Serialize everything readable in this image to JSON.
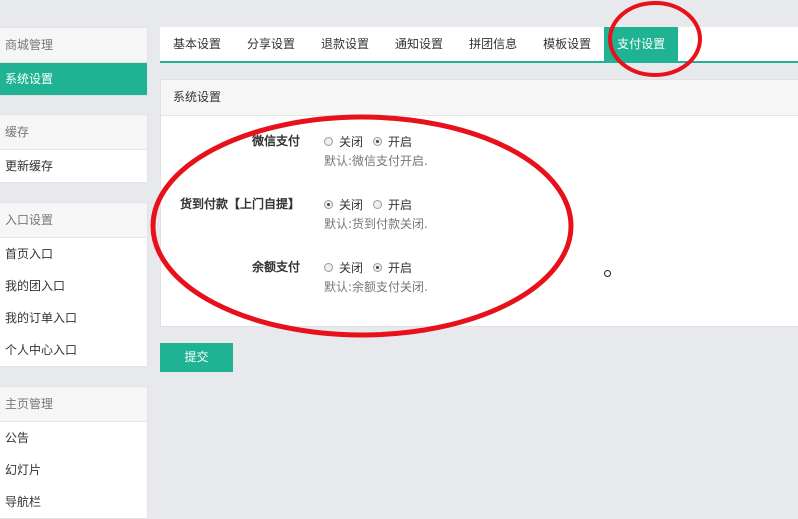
{
  "sidebar": {
    "groups": [
      {
        "title": "商城管理",
        "items": [
          "系统设置"
        ]
      },
      {
        "title": "缓存",
        "items": [
          "更新缓存"
        ]
      },
      {
        "title": "入口设置",
        "items": [
          "首页入口",
          "我的团入口",
          "我的订单入口",
          "个人中心入口"
        ]
      },
      {
        "title": "主页管理",
        "items": [
          "公告",
          "幻灯片",
          "导航栏"
        ]
      }
    ]
  },
  "tabs": [
    "基本设置",
    "分享设置",
    "退款设置",
    "通知设置",
    "拼团信息",
    "模板设置",
    "支付设置"
  ],
  "active_tab": "支付设置",
  "panel": {
    "title": "系统设置",
    "rows": [
      {
        "label": "微信支付",
        "options": [
          "关闭",
          "开启"
        ],
        "selected": "开启",
        "help": "默认:微信支付开启."
      },
      {
        "label": "货到付款【上门自提】",
        "options": [
          "关闭",
          "开启"
        ],
        "selected": "关闭",
        "help": "默认:货到付款关闭."
      },
      {
        "label": "余额支付",
        "options": [
          "关闭",
          "开启"
        ],
        "selected": "开启",
        "help": "默认:余额支付关闭."
      }
    ]
  },
  "submit_label": "提交",
  "annotation_color": "#e8101a",
  "accent_color": "#1fb394"
}
